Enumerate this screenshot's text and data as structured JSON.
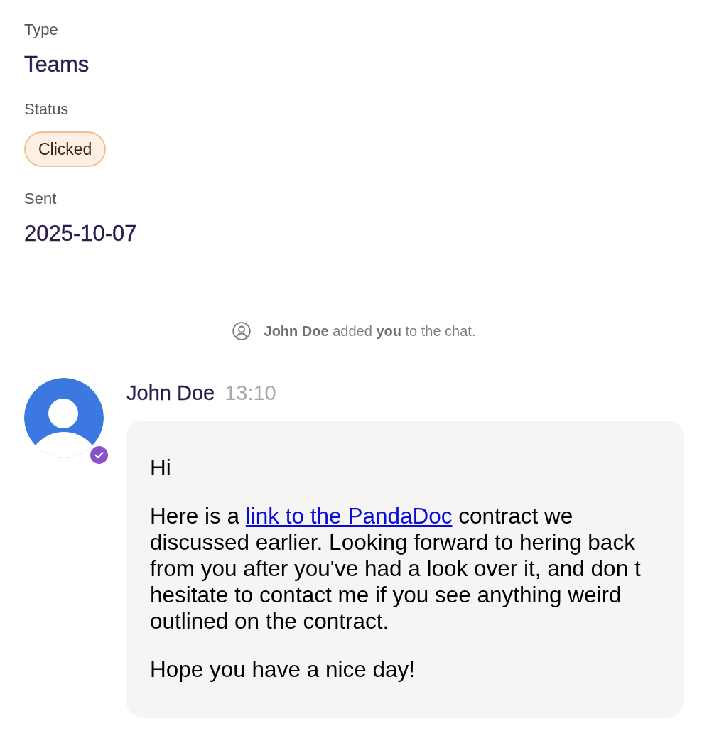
{
  "fields": [
    {
      "kind": "text",
      "label": "Type",
      "value": "Teams"
    },
    {
      "kind": "badge",
      "label": "Status",
      "value": "Clicked"
    },
    {
      "kind": "text",
      "label": "Sent",
      "value": "2025-10-07"
    }
  ],
  "system_message": "**John Doe** added **you** to the chat.",
  "message": {
    "author": "John Doe",
    "time": "13:10",
    "verified": true,
    "paragraphs": [
      [
        {
          "kind": "text",
          "text": "Hi"
        }
      ],
      [
        {
          "kind": "text",
          "text": "Here is a "
        },
        {
          "kind": "link",
          "text": "link to the PandaDoc"
        },
        {
          "kind": "text",
          "text": " contract we discussed earlier. Looking forward to hering back from you after you've had a look over it, and don t hesitate to contact me if you see anything weird outlined on the contract."
        }
      ],
      [
        {
          "kind": "text",
          "text": "Hope you have a nice day!"
        }
      ]
    ]
  }
}
